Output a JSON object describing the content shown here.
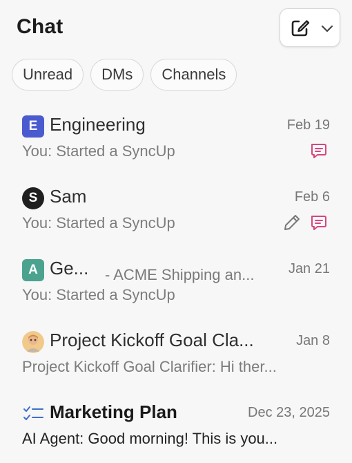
{
  "header": {
    "title": "Chat",
    "compose_icon": "new-message-icon",
    "chevron_icon": "chevron-down-icon"
  },
  "filters": [
    "Unread",
    "DMs",
    "Channels"
  ],
  "colors": {
    "engineering_avatar": "#4a5bd0",
    "sam_avatar": "#1f1f1f",
    "ge_avatar": "#4ba38f",
    "indicator_pink": "#d6467f",
    "checklist_blue": "#3d6fc8"
  },
  "conversations": [
    {
      "avatar_letter": "E",
      "name": "Engineering",
      "date": "Feb 19",
      "preview": "You: Started a SyncUp",
      "indicators": [
        "syncup-chat-icon"
      ]
    },
    {
      "avatar_letter": "S",
      "name": "Sam",
      "date": "Feb 6",
      "preview": "You: Started a SyncUp",
      "indicators": [
        "draft-pencil-icon",
        "syncup-chat-icon"
      ]
    },
    {
      "avatar_letter": "A",
      "name": "Ge...",
      "channel": "- ACME Shipping an...",
      "date": "Jan 21",
      "preview": "You: Started a SyncUp"
    },
    {
      "avatar_icon": "photo-avatar",
      "name": "Project Kickoff Goal Cla...",
      "date": "Jan 8",
      "preview": "Project Kickoff Goal Clarifier: Hi ther..."
    },
    {
      "avatar_icon": "checklist-icon",
      "name": "Marketing Plan",
      "date": "Dec 23, 2025",
      "preview": "AI Agent: Good morning! This is you..."
    }
  ]
}
